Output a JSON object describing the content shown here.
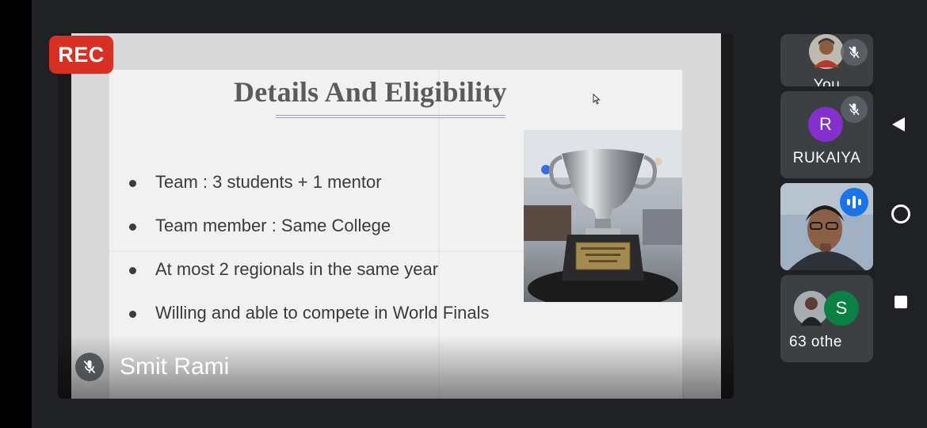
{
  "recording": {
    "label": "REC",
    "color": "#d93025"
  },
  "presentation": {
    "presenter_name": "Smit Rami",
    "slide": {
      "title": "Details And Eligibility",
      "bullets": [
        "Team :  3 students + 1 mentor",
        "Team member  :  Same College",
        "At most 2 regionals in the same year",
        "Willing and able to compete in World Finals"
      ],
      "image_icon": "trophy-photo"
    }
  },
  "participants": [
    {
      "label": "You",
      "muted": true,
      "avatar_icon": "user-photo"
    },
    {
      "label": "RUKAIYA",
      "initial": "R",
      "avatar_color": "#8430ce",
      "muted": true
    },
    {
      "label": "",
      "speaking": true,
      "avatar_icon": "camera-video"
    },
    {
      "label": "63 othe",
      "initial": "S",
      "avatar_color": "#0b8043",
      "avatar_icon": "user-photo"
    }
  ],
  "nav": {
    "back_icon": "back-triangle-icon",
    "home_icon": "home-circle-icon",
    "recent_icon": "recents-square-icon"
  }
}
